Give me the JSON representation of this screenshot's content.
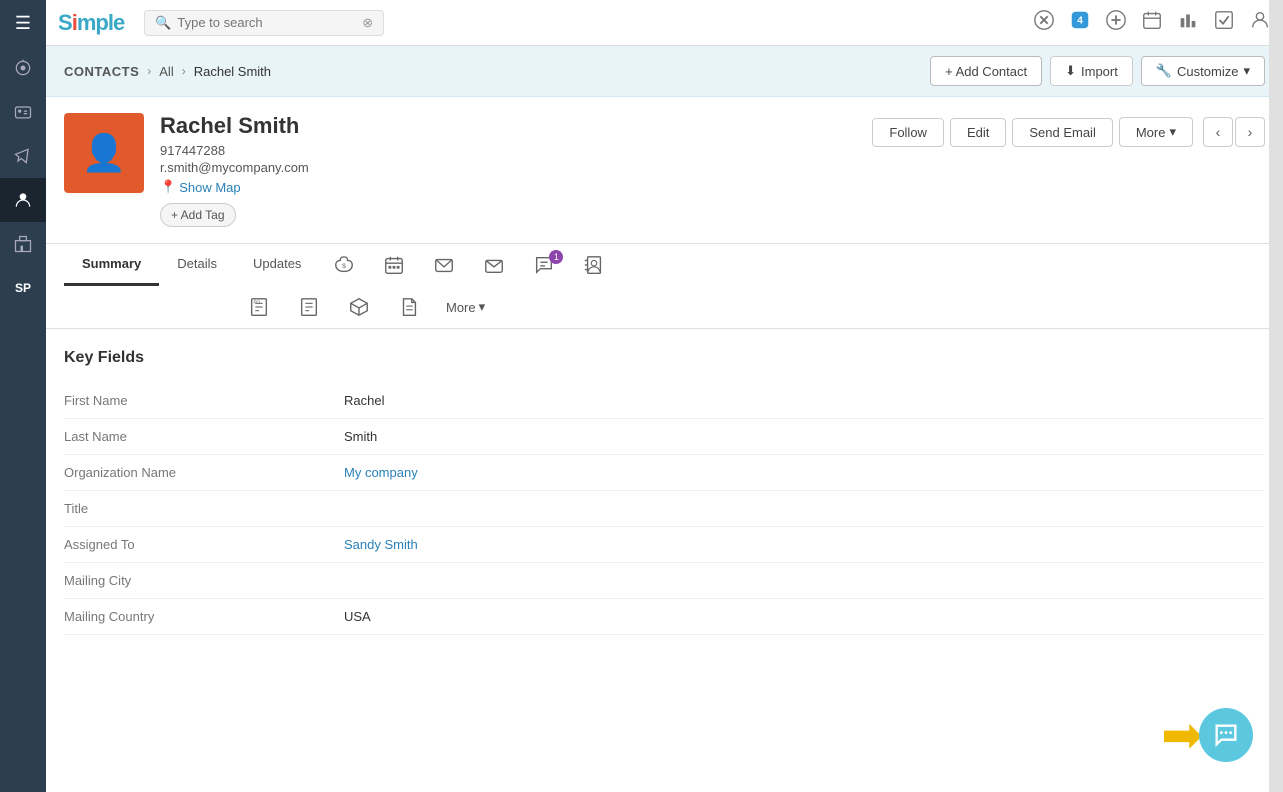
{
  "app": {
    "logo_text": "Simple",
    "logo_accent": "i"
  },
  "search": {
    "placeholder": "Type to search"
  },
  "top_icons": [
    "x-icon",
    "4-badge-icon",
    "plus-icon",
    "calendar-icon",
    "chart-icon",
    "check-icon",
    "user-icon"
  ],
  "nav": {
    "items": [
      {
        "id": "hamburger",
        "icon": "☰",
        "label": "menu"
      },
      {
        "id": "home",
        "icon": "⊙",
        "label": "home"
      },
      {
        "id": "contacts",
        "icon": "👥",
        "label": "contacts"
      },
      {
        "id": "megaphone",
        "icon": "📢",
        "label": "campaigns"
      },
      {
        "id": "person",
        "icon": "👤",
        "label": "person",
        "active": true
      },
      {
        "id": "building",
        "icon": "🏢",
        "label": "companies"
      },
      {
        "id": "sp",
        "icon": "SP",
        "label": "sp"
      }
    ]
  },
  "breadcrumb": {
    "section": "CONTACTS",
    "parent": "All",
    "current": "Rachel Smith"
  },
  "actions": {
    "add_contact": "+ Add Contact",
    "import": "Import",
    "customize": "Customize"
  },
  "contact": {
    "name": "Rachel Smith",
    "phone": "917447288",
    "email": "r.smith@mycompany.com",
    "show_map": "Show Map",
    "add_tag": "+ Add Tag",
    "buttons": {
      "follow": "Follow",
      "edit": "Edit",
      "send_email": "Send Email",
      "more": "More"
    }
  },
  "tabs": {
    "main": [
      "Summary",
      "Details",
      "Updates"
    ],
    "icons": [
      {
        "id": "money-bag",
        "symbol": "💰"
      },
      {
        "id": "calendar-grid",
        "symbol": "📅"
      },
      {
        "id": "email-open",
        "symbol": "✉"
      },
      {
        "id": "email-closed",
        "symbol": "📧"
      },
      {
        "id": "chat-badge",
        "symbol": "💬",
        "badge": "1"
      },
      {
        "id": "address-book",
        "symbol": "📇"
      },
      {
        "id": "purchase-order",
        "symbol": "🧾"
      },
      {
        "id": "sales-order",
        "symbol": "📋"
      },
      {
        "id": "box",
        "symbol": "📦"
      },
      {
        "id": "document",
        "symbol": "📄"
      },
      {
        "id": "more",
        "symbol": "More ▾"
      }
    ]
  },
  "key_fields": {
    "title": "Key Fields",
    "fields": [
      {
        "label": "First Name",
        "value": "Rachel",
        "type": "text"
      },
      {
        "label": "Last Name",
        "value": "Smith",
        "type": "text"
      },
      {
        "label": "Organization Name",
        "value": "My company",
        "type": "link"
      },
      {
        "label": "Title",
        "value": "",
        "type": "text"
      },
      {
        "label": "Assigned To",
        "value": "Sandy Smith",
        "type": "link"
      },
      {
        "label": "Mailing City",
        "value": "",
        "type": "text"
      },
      {
        "label": "Mailing Country",
        "value": "USA",
        "type": "text"
      }
    ]
  },
  "chat_widget": {
    "arrow": "➡",
    "bubble": "💬"
  }
}
